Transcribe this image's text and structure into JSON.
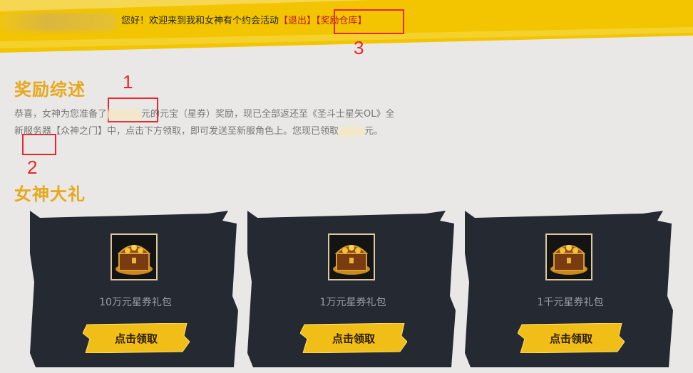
{
  "header": {
    "greeting": "您好！欢迎来到我和女神有个约会活动",
    "logout_label": "【退出】",
    "warehouse_label": "【奖励仓库】"
  },
  "annotations": [
    "1",
    "2",
    "3"
  ],
  "summary": {
    "title": "奖励综述",
    "text_1": "恭喜，女神为您准备了",
    "text_2": "元的元宝（星券）奖励，现已全部返还至《圣斗士星矢OL》全新服务器【众神之门】中，点击下方领取，即可发送至新服角色上。您现已领取",
    "text_3": "元。"
  },
  "gifts": {
    "title": "女神大礼",
    "items": [
      {
        "label": "10万元星券礼包",
        "button": "点击领取",
        "icon": "treasure-chest-icon"
      },
      {
        "label": "1万元星券礼包",
        "button": "点击领取",
        "icon": "treasure-chest-icon"
      },
      {
        "label": "1千元星券礼包",
        "button": "点击领取",
        "icon": "treasure-chest-icon"
      }
    ]
  },
  "colors": {
    "accent": "#e6a81c",
    "banner": "#f2c500",
    "card": "#252932",
    "annotation": "#e8262b"
  }
}
